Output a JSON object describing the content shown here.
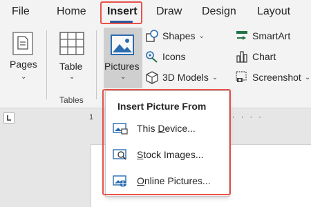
{
  "tabs": {
    "file": "File",
    "home": "Home",
    "insert": "Insert",
    "draw": "Draw",
    "design": "Design",
    "layout": "Layout"
  },
  "ribbon": {
    "pages": "Pages",
    "table": "Table",
    "tables_group": "Tables",
    "pictures": "Pictures",
    "shapes": "Shapes",
    "icons": "Icons",
    "models3d": "3D Models",
    "smartart": "SmartArt",
    "chart": "Chart",
    "screenshot": "Screenshot"
  },
  "ruler": {
    "marker": "1"
  },
  "dropdown": {
    "header": "Insert Picture From",
    "items": [
      {
        "pre": "This ",
        "u": "D",
        "post": "evice...",
        "icon": "device-picture-icon"
      },
      {
        "pre": "",
        "u": "S",
        "post": "tock Images...",
        "icon": "stock-images-icon"
      },
      {
        "pre": "",
        "u": "O",
        "post": "nline Pictures...",
        "icon": "online-pictures-icon"
      }
    ]
  },
  "colors": {
    "highlight": "#e8524a",
    "accent": "#2b579a",
    "icon_blue": "#2b6cb0",
    "icon_green": "#217346"
  }
}
